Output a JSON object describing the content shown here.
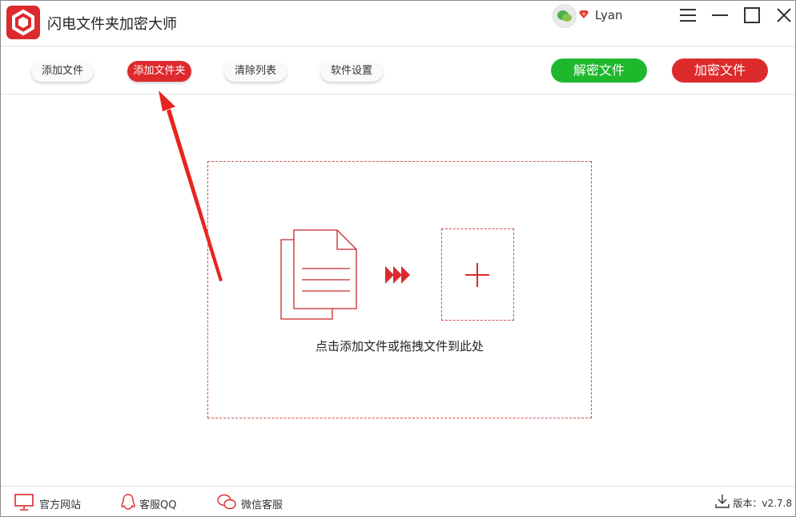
{
  "app": {
    "title": "闪电文件夹加密大师"
  },
  "user": {
    "name": "Lyan"
  },
  "toolbar": {
    "add_file": "添加文件",
    "add_folder": "添加文件夹",
    "clear_list": "清除列表",
    "settings": "软件设置",
    "decrypt": "解密文件",
    "encrypt": "加密文件"
  },
  "dropzone": {
    "hint": "点击添加文件或拖拽文件到此处"
  },
  "footer": {
    "website": "官方网站",
    "qq": "客服QQ",
    "wechat": "微信客服",
    "version": "版本：v2.7.8"
  },
  "colors": {
    "brand_red": "#dd2a2c",
    "decrypt_green": "#1fb82d"
  },
  "icons": [
    "logo-icon",
    "wechat-avatar-icon",
    "vip-diamond-icon",
    "menu-icon",
    "minimize-icon",
    "maximize-icon",
    "close-icon",
    "document-icon",
    "triple-arrow-icon",
    "plus-icon",
    "monitor-icon",
    "qq-icon",
    "wechat-icon",
    "download-icon"
  ]
}
